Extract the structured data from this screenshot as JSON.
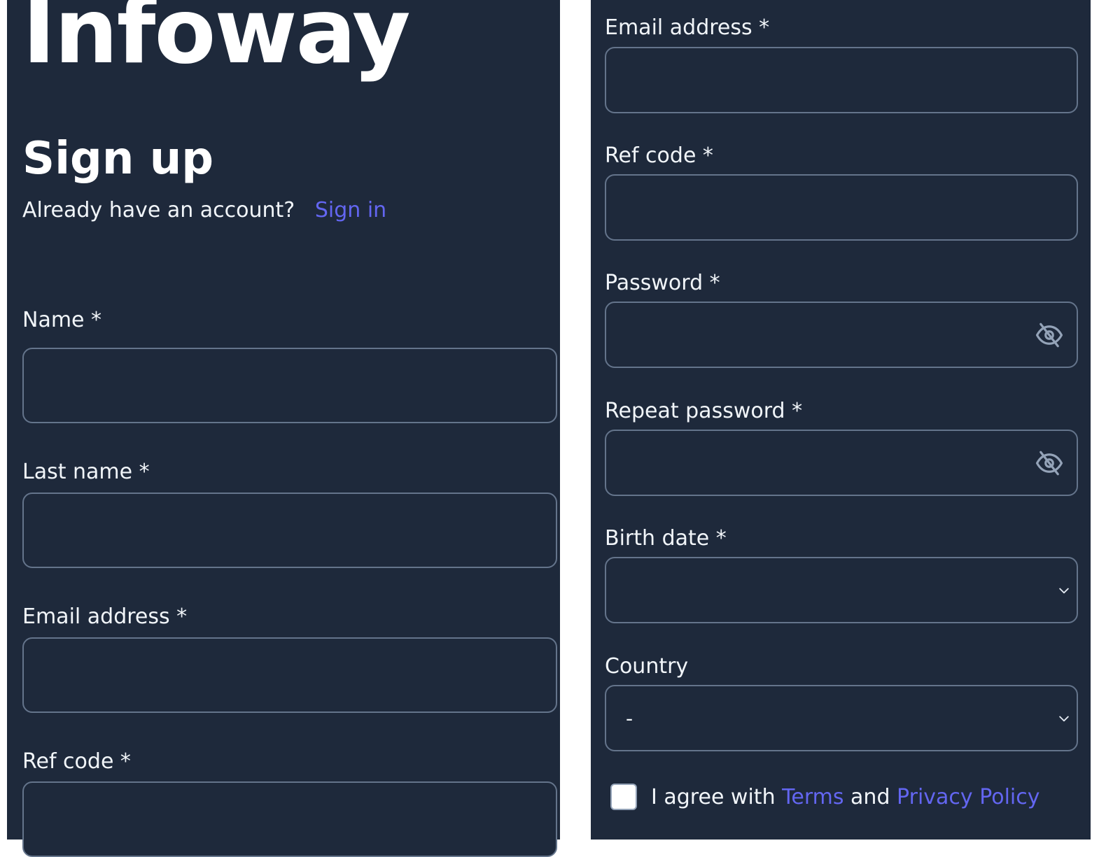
{
  "brand": {
    "name": "Infoway"
  },
  "signup": {
    "title": "Sign up",
    "account_prompt": "Already have an account?",
    "sign_in_link": "Sign in"
  },
  "left_form": {
    "name_label": "Name *",
    "last_name_label": "Last name *",
    "email_label": "Email address *",
    "ref_code_label": "Ref code *"
  },
  "right_form": {
    "email_label": "Email address *",
    "ref_code_label": "Ref code *",
    "password_label": "Password *",
    "repeat_password_label": "Repeat password *",
    "birth_date_label": "Birth date *",
    "birth_date_value": "",
    "country_label": "Country",
    "country_value": "-",
    "agree_prefix": "I agree with",
    "terms_link": "Terms",
    "and_text": "and",
    "privacy_link": "Privacy Policy"
  },
  "colors": {
    "panel_bg": "#1e293b",
    "link": "#6366f1",
    "border": "#64748b",
    "text": "#f1f5f9"
  },
  "icons": {
    "password_toggle": "eye-off-icon",
    "dropdown": "chevron-down-icon"
  }
}
